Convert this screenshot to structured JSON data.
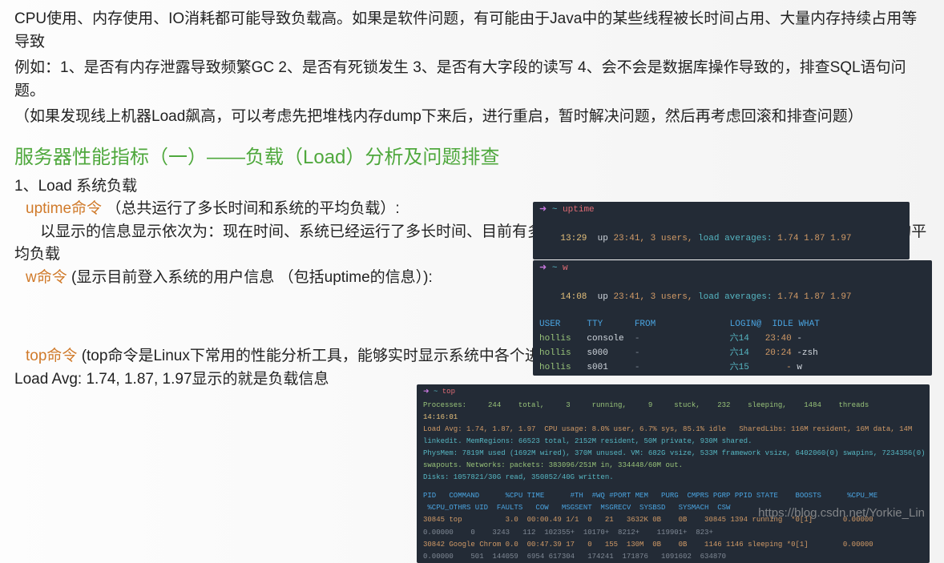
{
  "intro": {
    "p1": "CPU使用、内存使用、IO消耗都可能导致负载高。如果是软件问题，有可能由于Java中的某些线程被长时间占用、大量内存持续占用等导致",
    "p2": "例如：1、是否有内存泄露导致频繁GC  2、是否有死锁发生  3、是否有大字段的读写  4、会不会是数据库操作导致的，排查SQL语句问题。",
    "p3": "（如果发现线上机器Load飙高，可以考虑先把堆栈内存dump下来后，进行重启，暂时解决问题，然后再考虑回滚和排查问题）"
  },
  "heading": "服务器性能指标（一）——负载（Load）分析及问题排查",
  "section": {
    "loadTitle": "1、Load 系统负载",
    "uptimeCmd": "uptime命令",
    "uptimeDesc": "（总共运行了多长时间和系统的平均负载）:",
    "uptimeExplain": "以显示的信息显示依次为：现在时间、系统已经运行了多长时间、目前有多少登陆用户、系统在过去的1分钟、5分钟和15分钟内的平均负载",
    "wCmd": "w命令",
    "wDesc": " (显示目前登入系统的用户信息 （包括uptime的信息）):",
    "topCmd": "top命令",
    "topDesc": " (top命令是Linux下常用的性能分析工具，能够实时显示系统中各个进程的资源占用状况，类似于Windows的任务管理器)",
    "topLoadLine": "Load Avg: 1.74, 1.87, 1.97显示的就是负载信息"
  },
  "uptime": {
    "prompt": {
      "arrow": "➜",
      "tilde": "~",
      "cmd": "uptime"
    },
    "line": {
      "time": "13:29",
      "uptxt": "up",
      "upval": "23:41,",
      "users": "3 users,",
      "laLabel": "load averages:",
      "la": "1.74 1.87 1.97"
    }
  },
  "w": {
    "prompt": {
      "arrow": "➜",
      "tilde": "~",
      "cmd": "w"
    },
    "line": {
      "time": "14:08",
      "uptxt": "up",
      "upval": "23:41,",
      "users": "3 users,",
      "laLabel": "load averages:",
      "la": "1.74 1.87 1.97"
    },
    "hdr": "USER     TTY      FROM              LOGIN@  IDLE WHAT",
    "rows": [
      {
        "user": "hollis",
        "tty": "console",
        "from": "-",
        "day": "六14",
        "login": "23:40",
        "what": "-"
      },
      {
        "user": "hollis",
        "tty": "s000",
        "from": "-",
        "day": "六14",
        "login": "20:24",
        "what": "-zsh"
      },
      {
        "user": "hollis",
        "tty": "s001",
        "from": "-",
        "day": "六15",
        "login": "-",
        "what": "w"
      }
    ]
  },
  "top": {
    "prompt": {
      "arrow": "➜",
      "tilde": "~",
      "cmd": "top"
    },
    "proc": "Processes:     244    total,     3     running,     9     stuck,    232    sleeping,    1484    threads",
    "time": "14:16:01",
    "load": "Load Avg: 1.74, 1.87, 1.97  CPU usage: 8.0% user, 6.7% sys, 85.1% idle   SharedLibs: 116M resident, 16M data, 14M",
    "mem1": "linkedit. MemRegions: 66523 total, 2152M resident, 50M private, 930M shared.",
    "mem2": "PhysMem: 7819M used (1692M wired), 370M unused. VM: 682G vsize, 533M framework vsize, 6402060(0) swapins, 7234356(0)",
    "net": "swapouts. Networks: packets: 383096/251M in, 334448/60M out.",
    "disk": "Disks: 1057821/30G read, 350852/40G written.",
    "hdr1": "PID   COMMAND      %CPU TIME      #TH  #WQ #PORT MEM   PURG  CMPRS PGRP PPID STATE    BOOSTS      %CPU_ME",
    "hdr2": " %CPU_OTHRS UID  FAULTS   COW   MSGSENT  MSGRECV  SYSBSD   SYSMACH  CSW",
    "r1": "30845 top          3.0  00:00.49 1/1  0   21   3632K 0B    0B    30845 1394 running  *0[1]       0.00000",
    "r2": "0.00000    0    3243   112  102355+  10170+  8212+    119901+  823+",
    "r3": "30842 Google Chrom 0.0  00:47.39 17   0   155  130M  0B    0B    1146 1146 sleeping *0[1]        0.00000",
    "r4": "0.00000    501  144059  6954 617304   174241  171876   1091602  634870"
  },
  "watermark": "https://blog.csdn.net/Yorkie_Lin"
}
